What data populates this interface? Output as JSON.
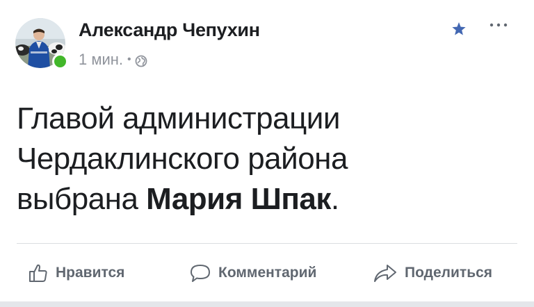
{
  "post": {
    "author": {
      "name": "Александр Чепухин",
      "online": true
    },
    "meta": {
      "time": "1 мин.",
      "separator": "•",
      "audience_icon": "globe-icon"
    },
    "text": {
      "line1": "Главой администрации",
      "line2": "Чердаклинского района",
      "line3_prefix": "выбрана ",
      "line3_bold": "Мария Шпак",
      "line3_suffix": "."
    },
    "header_icons": [
      "star-icon",
      "more-icon"
    ],
    "actions": {
      "like_label": "Нравится",
      "comment_label": "Комментарий",
      "share_label": "Поделиться"
    }
  },
  "colors": {
    "accent": "#4267b2",
    "online": "#42b72a",
    "text_primary": "#1c1e21",
    "text_secondary": "#90949c",
    "action_text": "#606770"
  }
}
